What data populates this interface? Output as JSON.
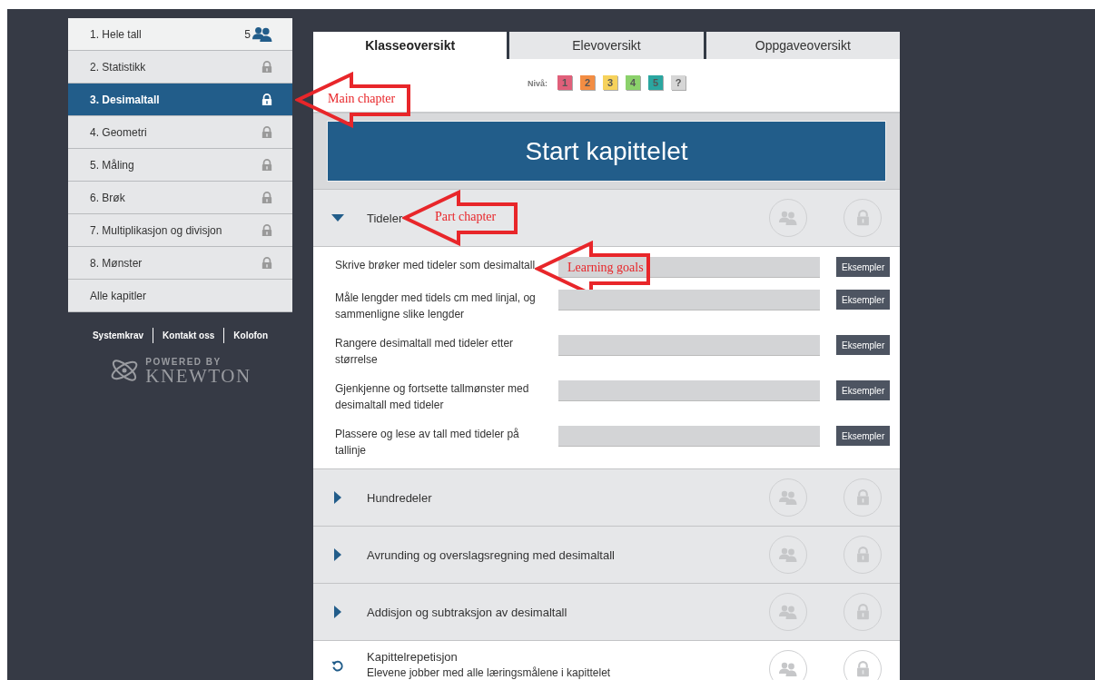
{
  "chapters": [
    {
      "label": "1. Hele tall",
      "kind": "count",
      "count": "5",
      "selected": false
    },
    {
      "label": "2. Statistikk",
      "kind": "locked",
      "selected": false
    },
    {
      "label": "3. Desimaltall",
      "kind": "locked",
      "selected": true,
      "annotation": "Main chapter"
    },
    {
      "label": "4. Geometri",
      "kind": "locked",
      "selected": false
    },
    {
      "label": "5. Måling",
      "kind": "locked",
      "selected": false
    },
    {
      "label": "6. Brøk",
      "kind": "locked",
      "selected": false
    },
    {
      "label": "7. Multiplikasjon og divisjon",
      "kind": "locked",
      "selected": false
    },
    {
      "label": "8. Mønster",
      "kind": "locked",
      "selected": false
    },
    {
      "label": "Alle kapitler",
      "kind": "plain",
      "selected": false
    }
  ],
  "footer_links": [
    "Systemkrav",
    "Kontakt oss",
    "Kolofon"
  ],
  "logo": {
    "tagline": "POWERED BY",
    "name": "KNEWTON"
  },
  "tabs": [
    {
      "label": "Klasseoversikt",
      "selected": true
    },
    {
      "label": "Elevoversikt",
      "selected": false
    },
    {
      "label": "Oppgaveoversikt",
      "selected": false
    }
  ],
  "levels": {
    "label": "Nivå:",
    "items": [
      {
        "label": "1",
        "color": "#e0607a"
      },
      {
        "label": "2",
        "color": "#f38d43"
      },
      {
        "label": "3",
        "color": "#f6d25c"
      },
      {
        "label": "4",
        "color": "#8bd16b"
      },
      {
        "label": "5",
        "color": "#2aa6a0"
      },
      {
        "label": "?",
        "color": "#d6d6d6"
      }
    ]
  },
  "start_button": "Start kapittelet",
  "sections": [
    {
      "kind": "part",
      "title": "Tideler",
      "expanded": true,
      "annotation": "Part chapter",
      "goals": [
        {
          "text": "Skrive brøker med tideler som desimaltall",
          "button": "Eksempler",
          "annotation": "Learning goals"
        },
        {
          "text": "Måle lengder med tidels cm med linjal, og sammenligne slike lengder",
          "button": "Eksempler"
        },
        {
          "text": "Rangere desimaltall med tideler etter størrelse",
          "button": "Eksempler"
        },
        {
          "text": "Gjenkjenne og fortsette tallmønster med desimaltall med tideler",
          "button": "Eksempler"
        },
        {
          "text": "Plassere og lese av tall med tideler på tallinje",
          "button": "Eksempler"
        }
      ]
    },
    {
      "kind": "part",
      "title": "Hundredeler",
      "expanded": false
    },
    {
      "kind": "part",
      "title": "Avrunding og overslagsregning med desimaltall",
      "expanded": false
    },
    {
      "kind": "part",
      "title": "Addisjon og subtraksjon av desimaltall",
      "expanded": false
    },
    {
      "kind": "repetition",
      "title": "Kapittelrepetisjon",
      "subtitle": "Elevene jobber med alle læringsmålene i kapittelet"
    }
  ]
}
